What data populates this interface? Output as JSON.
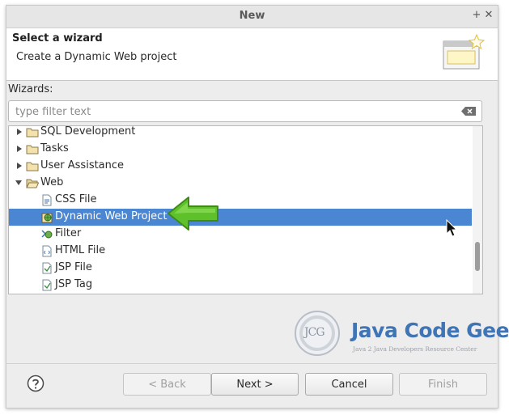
{
  "window": {
    "title": "New"
  },
  "header": {
    "title": "Select a wizard",
    "subtitle": "Create a Dynamic Web project"
  },
  "wizards_label": "Wizards:",
  "filter": {
    "placeholder": "type filter text",
    "value": ""
  },
  "tree": {
    "items": [
      {
        "label": "SQL Development",
        "type": "folder",
        "expanded": false
      },
      {
        "label": "Tasks",
        "type": "folder",
        "expanded": false
      },
      {
        "label": "User Assistance",
        "type": "folder",
        "expanded": false
      },
      {
        "label": "Web",
        "type": "folder",
        "expanded": true
      },
      {
        "label": "CSS File",
        "type": "file"
      },
      {
        "label": "Dynamic Web Project",
        "type": "project",
        "selected": true
      },
      {
        "label": "Filter",
        "type": "filter"
      },
      {
        "label": "HTML File",
        "type": "file"
      },
      {
        "label": "JSP File",
        "type": "file"
      },
      {
        "label": "JSP Tag",
        "type": "file"
      }
    ]
  },
  "watermark": {
    "name": "Java Code Geeks",
    "tagline": "Java 2 Java Developers Resource Center",
    "monogram": "JCG"
  },
  "buttons": {
    "back": "< Back",
    "next": "Next >",
    "cancel": "Cancel",
    "finish": "Finish"
  },
  "colors": {
    "selection": "#4a86d1",
    "arrow": "#5ec02a",
    "logo_blue": "#3f74b5"
  }
}
